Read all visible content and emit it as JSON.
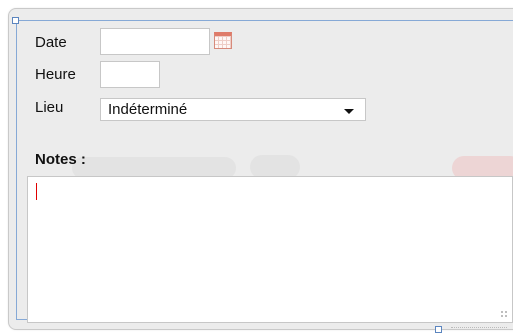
{
  "form": {
    "date_label": "Date",
    "date_value": "",
    "time_label": "Heure",
    "time_value": "",
    "place_label": "Lieu",
    "place_value": "Indéterminé",
    "notes_label": "Notes :",
    "notes_value": ""
  },
  "icons": {
    "calendar": "calendar-icon",
    "dropdown": "chevron-down-icon"
  },
  "colors": {
    "background": "#ececec",
    "input_border": "#c7c7c7",
    "caret": "#e00000",
    "selection_border": "#86a9d6"
  }
}
